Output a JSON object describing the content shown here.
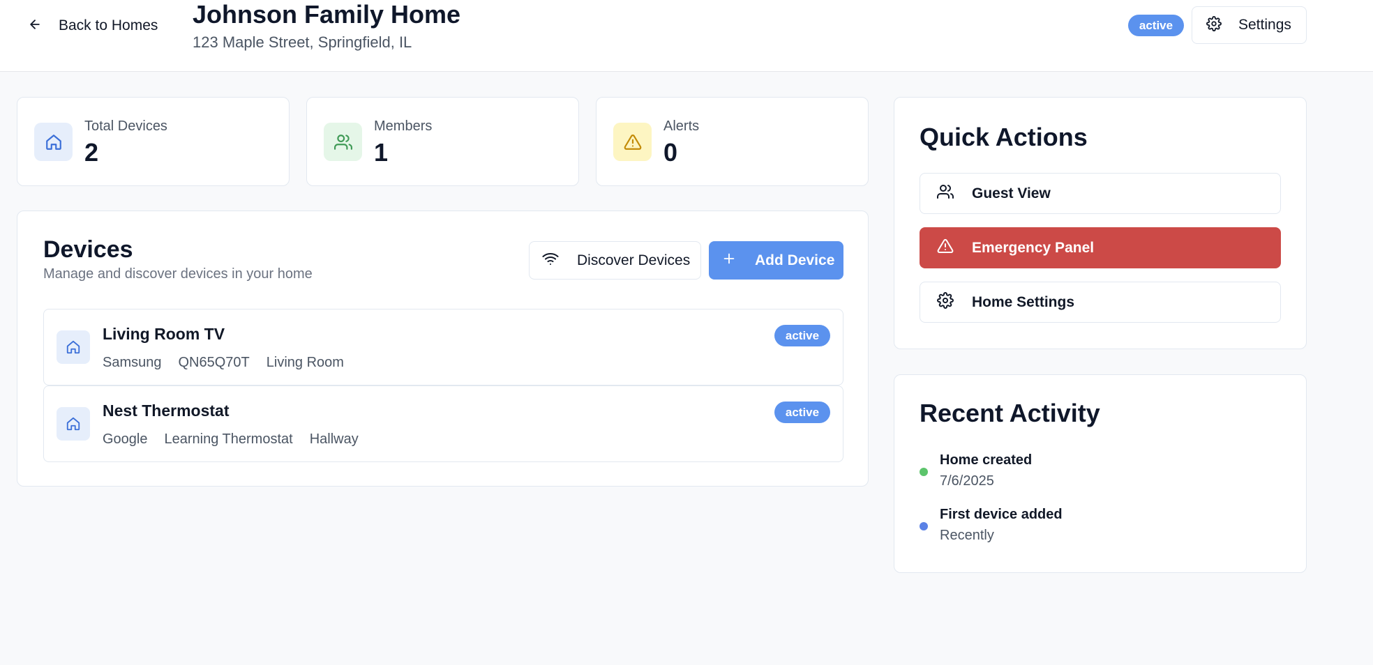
{
  "header": {
    "back_label": "Back to Homes",
    "title": "Johnson Family Home",
    "address": "123 Maple Street, Springfield, IL",
    "status": "active",
    "settings_label": "Settings"
  },
  "stats": [
    {
      "label": "Total Devices",
      "value": "2",
      "icon": "home-icon",
      "icon_bg": "#e6eefb",
      "icon_color": "#3b6fd8"
    },
    {
      "label": "Members",
      "value": "1",
      "icon": "users-icon",
      "icon_bg": "#e5f6e8",
      "icon_color": "#3f9a56"
    },
    {
      "label": "Alerts",
      "value": "0",
      "icon": "warning-icon",
      "icon_bg": "#fdf5c2",
      "icon_color": "#c28a06"
    }
  ],
  "devices": {
    "title": "Devices",
    "subtitle": "Manage and discover devices in your home",
    "discover_label": "Discover Devices",
    "add_label": "Add Device",
    "items": [
      {
        "name": "Living Room TV",
        "brand": "Samsung",
        "model": "QN65Q70T",
        "room": "Living Room",
        "status": "active"
      },
      {
        "name": "Nest Thermostat",
        "brand": "Google",
        "model": "Learning Thermostat",
        "room": "Hallway",
        "status": "active"
      }
    ]
  },
  "quick_actions": {
    "title": "Quick Actions",
    "items": [
      {
        "label": "Guest View",
        "icon": "users-icon"
      },
      {
        "label": "Emergency Panel",
        "icon": "warning-icon"
      },
      {
        "label": "Home Settings",
        "icon": "gear-icon"
      }
    ]
  },
  "recent_activity": {
    "title": "Recent Activity",
    "items": [
      {
        "title": "Home created",
        "time": "7/6/2025",
        "dot_color": "#5cc46b"
      },
      {
        "title": "First device added",
        "time": "Recently",
        "dot_color": "#5b82e6"
      }
    ]
  },
  "colors": {
    "accent": "#5b92ee",
    "danger": "#cc4a47"
  }
}
